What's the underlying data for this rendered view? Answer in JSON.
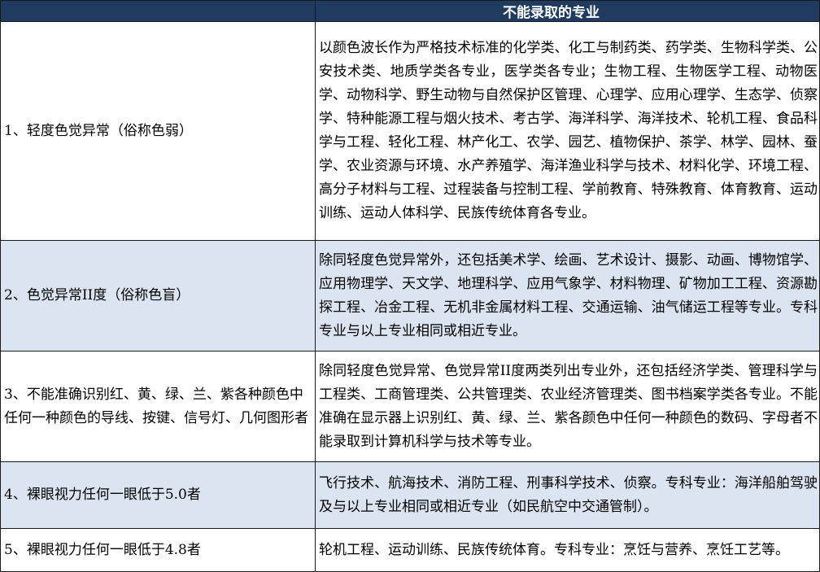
{
  "table": {
    "header": "不能录取的专业",
    "rows": [
      {
        "condition": "1、轻度色觉异常（俗称色弱）",
        "majors": "以颜色波长作为严格技术标准的化学类、化工与制药类、药学类、生物科学类、公安技术类、地质学类各专业，医学类各专业；生物工程、生物医学工程、动物医学、动物科学、野生动物与自然保护区管理、心理学、应用心理学、生态学、侦察学、特种能源工程与烟火技术、考古学、海洋科学、海洋技术、轮机工程、食品科学与工程、轻化工程、林产化工、农学、园艺、植物保护、茶学、林学、园林、蚕学、农业资源与环境、水产养殖学、海洋渔业科学与技术、材料化学、环境工程、高分子材料与工程、过程装备与控制工程、学前教育、特殊教育、体育教育、运动训练、运动人体科学、民族传统体育各专业。"
      },
      {
        "condition": "2、色觉异常II度（俗称色盲）",
        "majors": "除同轻度色觉异常外，还包括美术学、绘画、艺术设计、摄影、动画、博物馆学、应用物理学、天文学、地理科学、应用气象学、材料物理、矿物加工工程、资源勘探工程、冶金工程、无机非金属材料工程、交通运输、油气储运工程等专业。专科专业与以上专业相同或相近专业。"
      },
      {
        "condition": "3、不能准确识别红、黄、绿、兰、紫各种颜色中任何一种颜色的导线、按键、信号灯、几何图形者",
        "majors": "除同轻度色觉异常、色觉异常II度两类列出专业外，还包括经济学类、管理科学与工程类、工商管理类、公共管理类、农业经济管理类、图书档案学类各专业。不能准确在显示器上识别红、黄、绿、兰、紫各颜色中任何一种颜色的数码、字母者不能录取到计算机科学与技术等专业。"
      },
      {
        "condition": "4、裸眼视力任何一眼低于5.0者",
        "majors": "飞行技术、航海技术、消防工程、刑事科学技术、侦察。专科专业：海洋船舶驾驶及与以上专业相同或相近专业（如民航空中交通管制）。"
      },
      {
        "condition": "5、裸眼视力任何一眼低于4.8者",
        "majors": "轮机工程、运动训练、民族传统体育。专科专业：烹饪与营养、烹饪工艺等。"
      }
    ]
  }
}
